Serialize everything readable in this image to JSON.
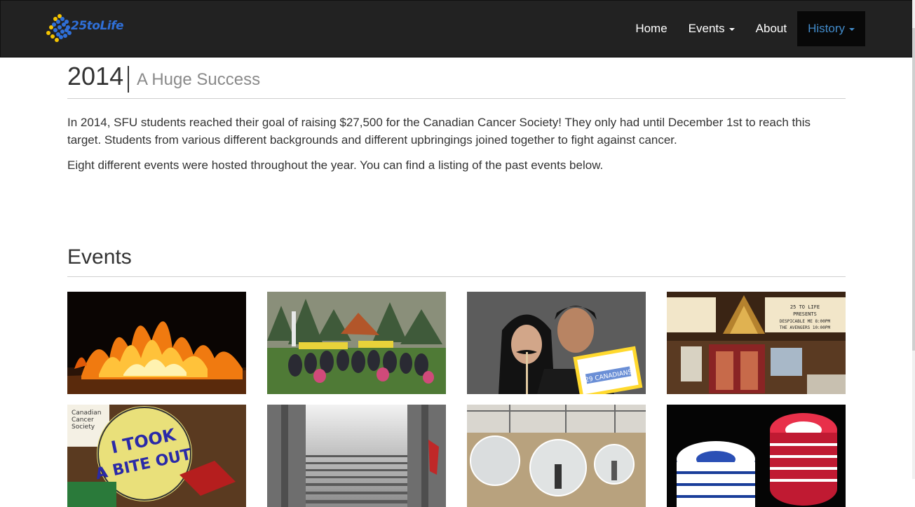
{
  "brand": {
    "logo_text": "25toLife"
  },
  "nav": {
    "items": [
      {
        "label": "Home",
        "dropdown": false,
        "active": false
      },
      {
        "label": "Events",
        "dropdown": true,
        "active": false
      },
      {
        "label": "About",
        "dropdown": false,
        "active": false
      },
      {
        "label": "History",
        "dropdown": true,
        "active": true
      }
    ]
  },
  "header": {
    "year": "2014",
    "subtitle": "A Huge Success"
  },
  "intro": {
    "p1": "In 2014, SFU students reached their goal of raising $27,500 for the Canadian Cancer Society! They only had until December 1st to reach this target. Students from various different backgrounds and different upbringings joined together to fight against cancer.",
    "p2": "Eight different events were hosted throughout the year. You can find a listing of the past events below."
  },
  "events": {
    "title": "Events",
    "thumbnails": [
      {
        "name": "fire-photo",
        "overlay": ""
      },
      {
        "name": "group-photo",
        "overlay": ""
      },
      {
        "name": "mustache-photo",
        "overlay": "29 CANADIANS"
      },
      {
        "name": "theatre-photo",
        "overlay": "25 TO LIFE PRESENTS DESPICABLE ME 8:00PM THE AVENGERS 10:00PM"
      },
      {
        "name": "bite-sign-photo",
        "overlay": "I TOOK A BITE OUT"
      },
      {
        "name": "stairs-photo",
        "overlay": ""
      },
      {
        "name": "bubble-soccer-photo",
        "overlay": ""
      },
      {
        "name": "poker-chips-photo",
        "overlay": ""
      }
    ]
  },
  "colors": {
    "navbar": "#222222",
    "active_link": "#428bca",
    "logo_blue": "#2f6fd8",
    "logo_yellow": "#f5c400"
  }
}
